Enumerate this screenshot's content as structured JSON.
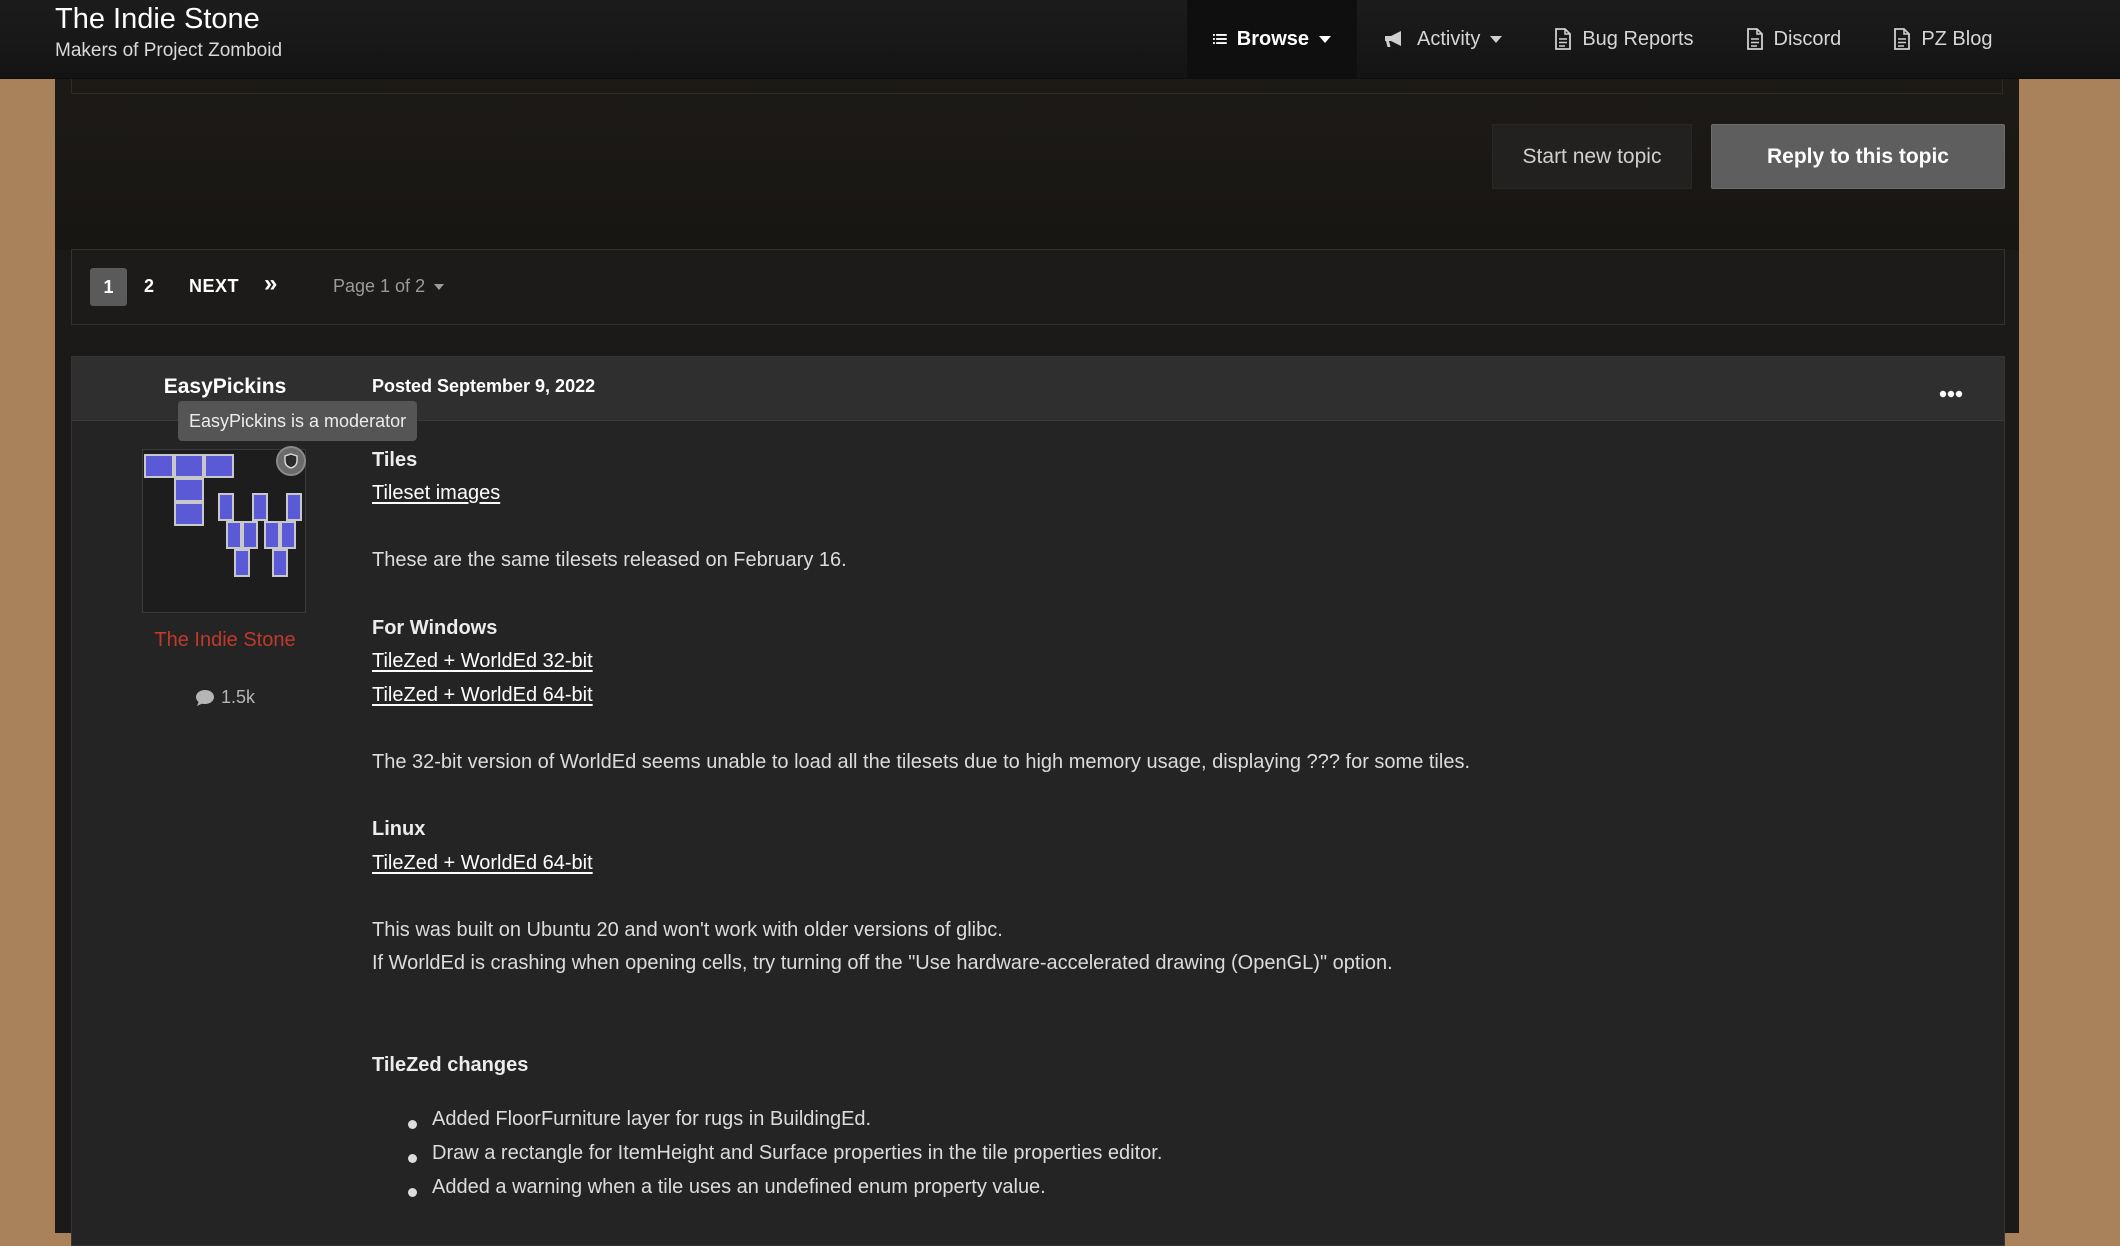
{
  "header": {
    "site_title": "The Indie Stone",
    "site_subtitle": "Makers of Project Zomboid",
    "nav": {
      "browse": "Browse",
      "activity": "Activity",
      "bug_reports": "Bug Reports",
      "discord": "Discord",
      "pz_blog": "PZ Blog"
    }
  },
  "actions": {
    "start_topic": "Start new topic",
    "reply_topic": "Reply to this topic"
  },
  "pagination": {
    "current": "1",
    "next_page": "2",
    "next": "NEXT",
    "last": "»",
    "page_jump": "Page 1 of 2"
  },
  "post": {
    "author": "EasyPickins",
    "tooltip": "EasyPickins is a moderator",
    "group": "The Indie Stone",
    "post_count": "1.5k",
    "date": "Posted September 9, 2022",
    "content": {
      "tiles_heading": "Tiles",
      "tileset_link": "Tileset images",
      "tilesets_note": "These are the same tilesets released on February 16.",
      "windows_heading": "For Windows",
      "win32_link": "TileZed + WorldEd 32-bit",
      "win64_link": "TileZed + WorldEd 64-bit",
      "win32_note": "The 32-bit version of WorldEd seems unable to load all the tilesets due to high memory usage, displaying ??? for some tiles.",
      "linux_heading": "Linux",
      "linux64_link": "TileZed + WorldEd 64-bit",
      "linux_note1": "This was built on Ubuntu 20 and won't work with older versions of glibc.",
      "linux_note2": "If WorldEd is crashing when opening cells, try turning off the \"Use hardware-accelerated drawing (OpenGL)\" option.",
      "changes_heading": "TileZed changes",
      "changes": [
        "Added FloorFurniture layer for rugs in BuildingEd.",
        "Draw a rectangle for ItemHeight and Surface properties in the tile properties editor.",
        "Added a warning when a tile uses an undefined enum property value."
      ]
    }
  },
  "colors": {
    "page_background": "#a9825c",
    "group_color": "#c0392b",
    "avatar_tile": "#5a5ad6"
  }
}
